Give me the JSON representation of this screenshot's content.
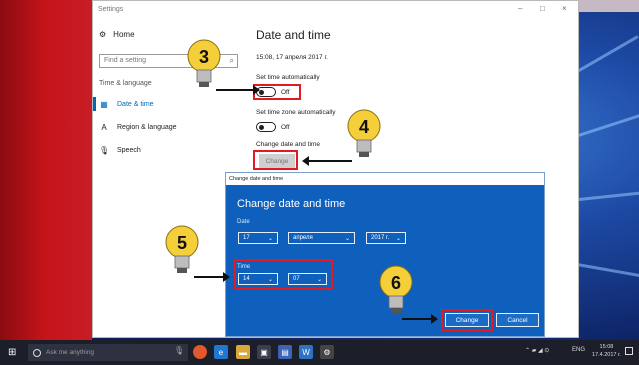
{
  "window": {
    "title": "Settings",
    "controls": [
      "–",
      "□",
      "×"
    ]
  },
  "sidebar": {
    "home": {
      "icon": "gear-icon",
      "label": "Home"
    },
    "search_placeholder": "Find a setting",
    "section": "Time & language",
    "items": [
      {
        "icon": "calendar-clock-icon",
        "label": "Date & time",
        "active": true
      },
      {
        "icon": "language-icon",
        "label": "Region & language"
      },
      {
        "icon": "microphone-icon",
        "label": "Speech"
      }
    ]
  },
  "main": {
    "title": "Date and time",
    "current_datetime": "15:08, 17 апреля 2017 г.",
    "set_time_auto_label": "Set time automatically",
    "set_time_auto_state": "Off",
    "set_timezone_auto_label": "Set time zone automatically",
    "set_timezone_auto_state": "Off",
    "change_label": "Change date and time",
    "change_button": "Change"
  },
  "dialog": {
    "titlebar": "Change date and time",
    "heading": "Change date and time",
    "date_label": "Date",
    "day": "17",
    "month": "апреля",
    "year": "2017 г.",
    "time_label": "Time",
    "hour": "14",
    "minute": "07",
    "change_button": "Change",
    "cancel_button": "Cancel"
  },
  "callouts": {
    "step3": "3",
    "step4": "4",
    "step5": "5",
    "step6": "6"
  },
  "taskbar": {
    "search_placeholder": "Ask me anything",
    "tray_language": "ENG",
    "clock_time": "15:08",
    "clock_date": "17.4.2017 г."
  },
  "colors": {
    "highlight_red": "#e21b22",
    "dialog_blue": "#0f5fbd",
    "accent": "#0067b8"
  }
}
